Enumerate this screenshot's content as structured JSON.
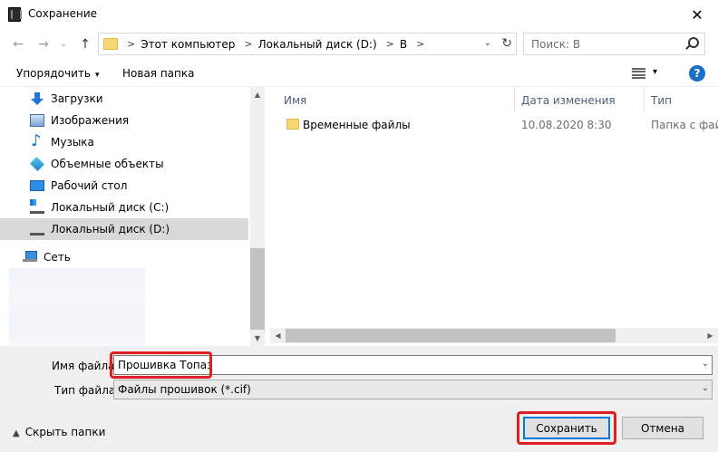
{
  "window": {
    "title": "Сохранение",
    "close_icon": "✕"
  },
  "nav": {
    "back_icon": "←",
    "forward_icon": "→",
    "recent_icon": "⌄",
    "up_icon": "↑",
    "breadcrumbs": [
      "Этот компьютер",
      "Локальный диск (D:)",
      "B"
    ],
    "breadcrumb_separator": ">",
    "search_placeholder": "Поиск: B"
  },
  "toolbar": {
    "organize_label": "Упорядочить",
    "organize_caret": "▾",
    "new_folder_label": "Новая папка",
    "view_caret": "▾",
    "help_label": "?"
  },
  "sidebar": {
    "items": [
      {
        "label": "Загрузки",
        "icon": "downloads-icon"
      },
      {
        "label": "Изображения",
        "icon": "pictures-icon"
      },
      {
        "label": "Музыка",
        "icon": "music-icon"
      },
      {
        "label": "Объемные объекты",
        "icon": "3d-objects-icon"
      },
      {
        "label": "Рабочий стол",
        "icon": "desktop-icon"
      },
      {
        "label": "Локальный диск (C:)",
        "icon": "drive-c-icon"
      },
      {
        "label": "Локальный диск (D:)",
        "icon": "drive-d-icon",
        "selected": true
      }
    ],
    "network_label": "Сеть"
  },
  "file_list": {
    "columns": [
      "Имя",
      "Дата изменения",
      "Тип"
    ],
    "sort_caret": "^",
    "rows": [
      {
        "name": "Временные файлы",
        "date": "10.08.2020 8:30",
        "type": "Папка с фай"
      }
    ]
  },
  "form": {
    "file_name_label": "Имя файла:",
    "file_name_value": "Прошивка Топаз",
    "file_type_label": "Тип файла:",
    "file_type_value": "Файлы прошивок (*.cif)",
    "hide_folders_label": "Скрыть папки",
    "save_label": "Сохранить",
    "cancel_label": "Отмена"
  },
  "colors": {
    "highlight": "#e02020",
    "accent": "#0078d7",
    "selected_bg": "#d9d9d9"
  }
}
